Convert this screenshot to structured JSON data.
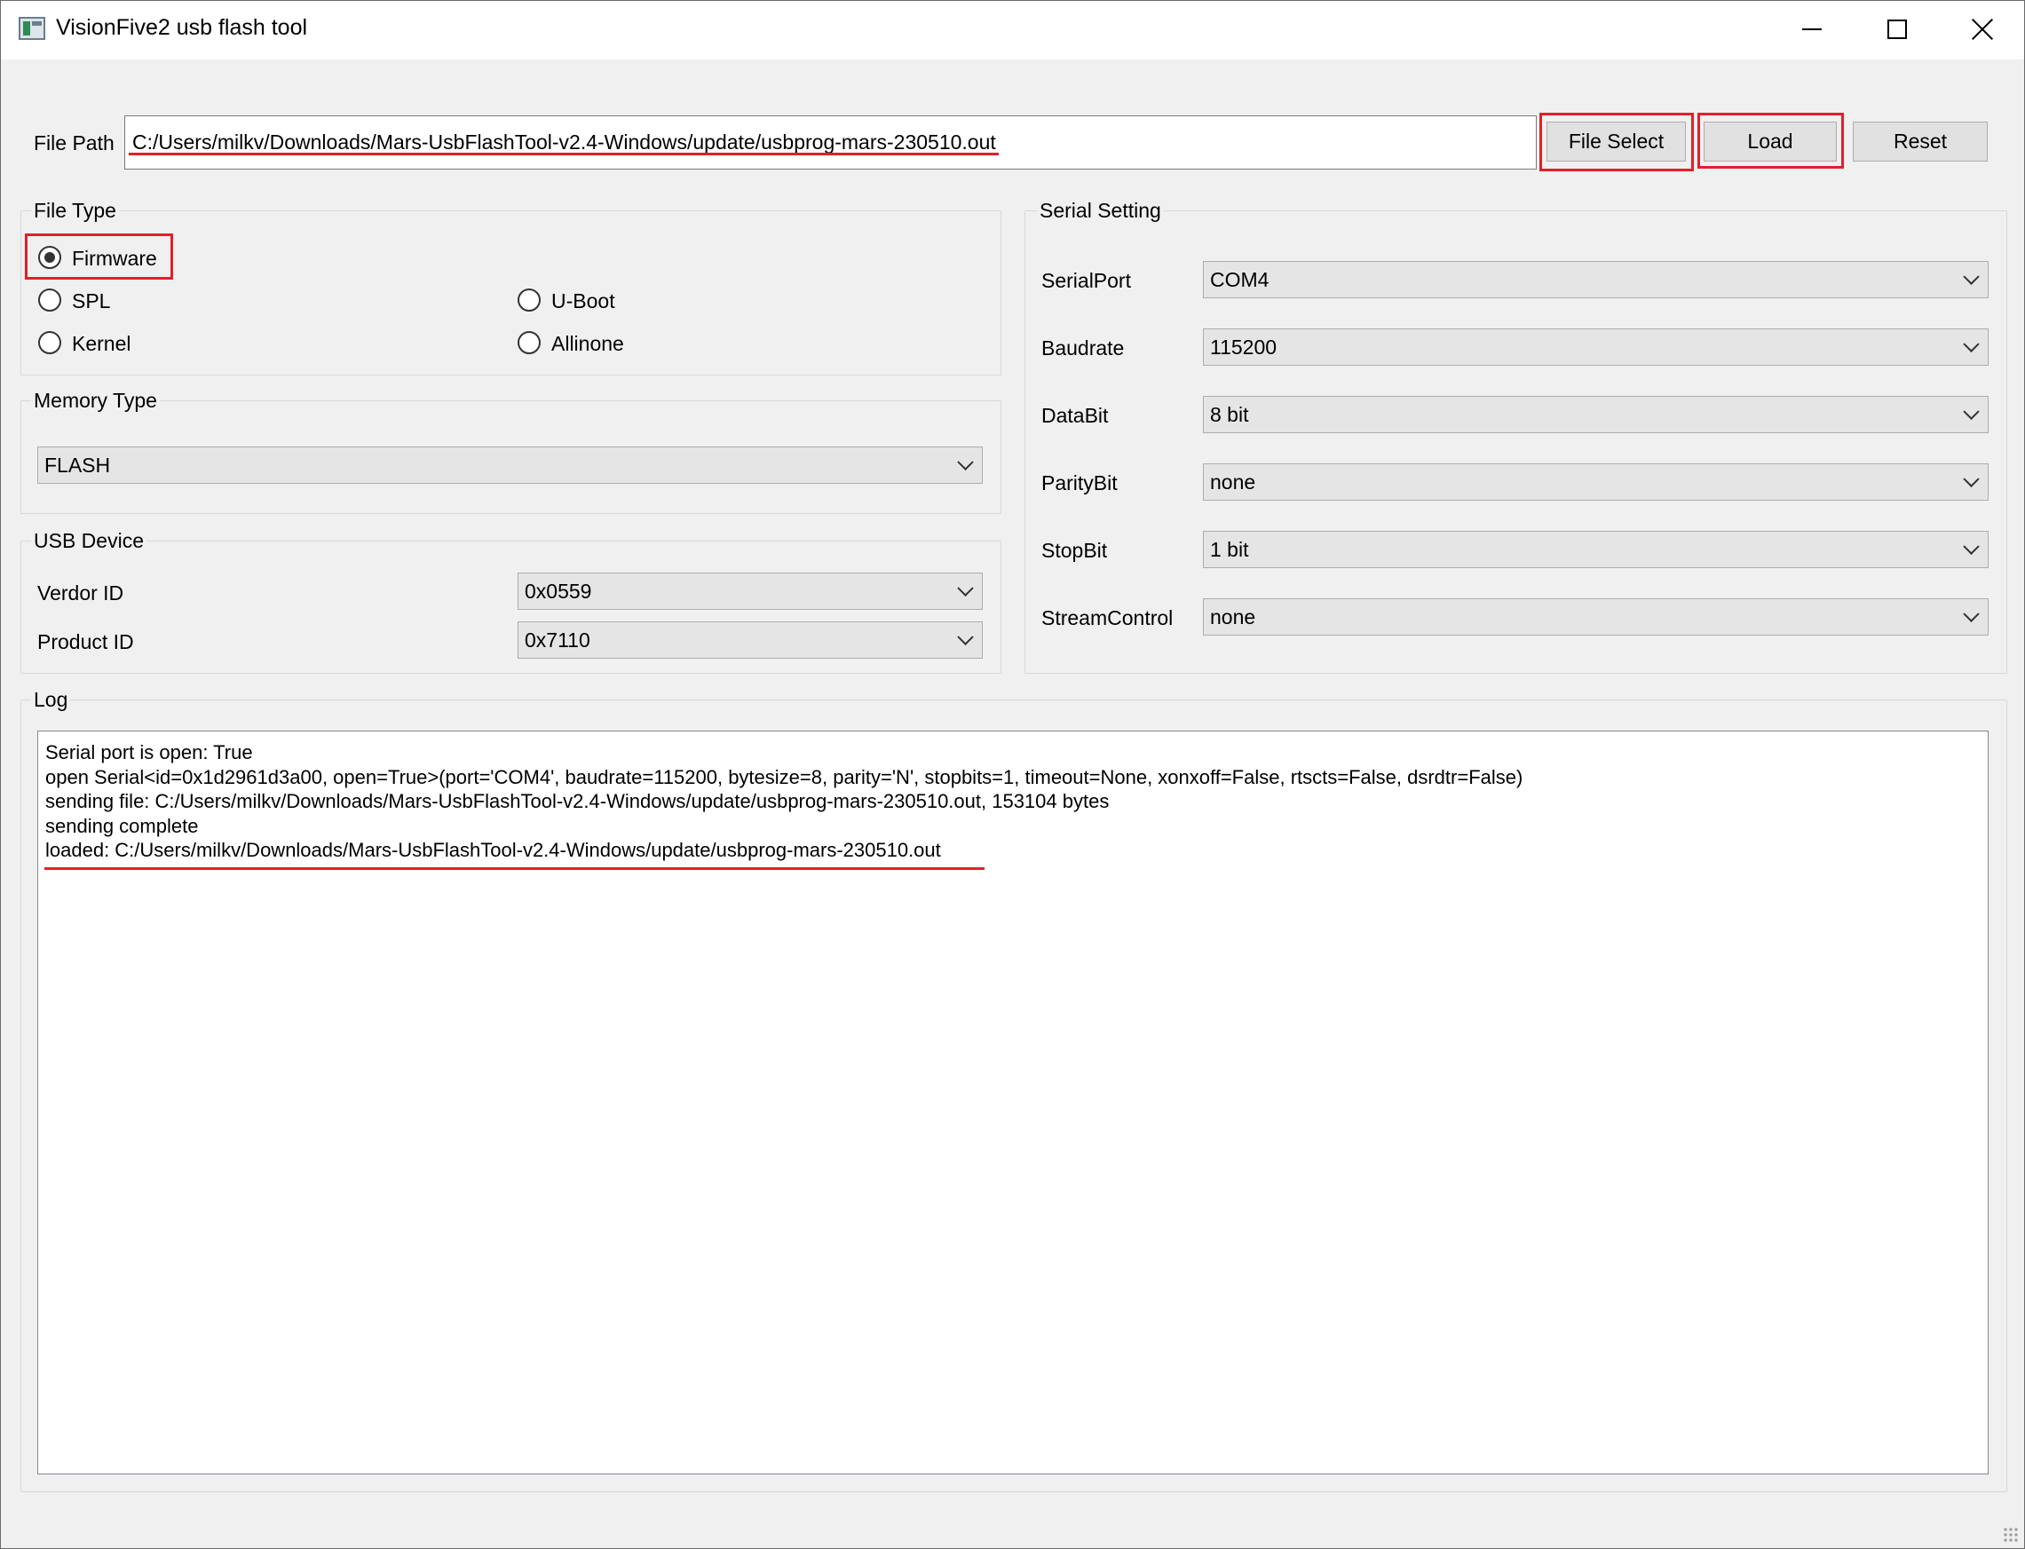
{
  "window": {
    "title": "VisionFive2 usb flash tool"
  },
  "file_path": {
    "label": "File Path",
    "value": "C:/Users/milkv/Downloads/Mars-UsbFlashTool-v2.4-Windows/update/usbprog-mars-230510.out",
    "buttons": {
      "file_select": "File Select",
      "load": "Load",
      "reset": "Reset"
    }
  },
  "file_type": {
    "title": "File Type",
    "options": {
      "firmware": "Firmware",
      "spl": "SPL",
      "uboot": "U-Boot",
      "kernel": "Kernel",
      "allinone": "Allinone"
    },
    "selected": "Firmware"
  },
  "memory_type": {
    "title": "Memory Type",
    "value": "FLASH"
  },
  "usb_device": {
    "title": "USB Device",
    "vendor_label": "Verdor ID",
    "vendor_value": "0x0559",
    "product_label": "Product ID",
    "product_value": "0x7110"
  },
  "serial_setting": {
    "title": "Serial Setting",
    "serial_port": {
      "label": "SerialPort",
      "value": "COM4"
    },
    "baudrate": {
      "label": "Baudrate",
      "value": "115200"
    },
    "databit": {
      "label": "DataBit",
      "value": "8 bit"
    },
    "paritybit": {
      "label": "ParityBit",
      "value": "none"
    },
    "stopbit": {
      "label": "StopBit",
      "value": "1 bit"
    },
    "streamcontrol": {
      "label": "StreamControl",
      "value": "none"
    }
  },
  "log": {
    "title": "Log",
    "lines": [
      "Serial port is open: True",
      "open Serial<id=0x1d2961d3a00, open=True>(port='COM4', baudrate=115200, bytesize=8, parity='N', stopbits=1, timeout=None, xonxoff=False, rtscts=False, dsrdtr=False)",
      "sending file: C:/Users/milkv/Downloads/Mars-UsbFlashTool-v2.4-Windows/update/usbprog-mars-230510.out, 153104 bytes",
      "sending complete",
      "loaded: C:/Users/milkv/Downloads/Mars-UsbFlashTool-v2.4-Windows/update/usbprog-mars-230510.out"
    ]
  },
  "colors": {
    "highlight": "#e0202a",
    "window_bg": "#f0f0f0"
  }
}
